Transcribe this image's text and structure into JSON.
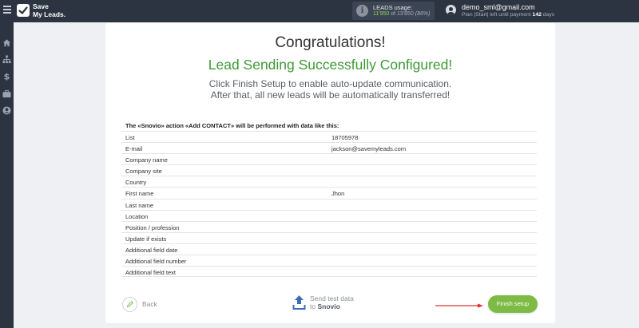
{
  "topbar": {
    "logo_line1": "Save",
    "logo_line2": "My Leads.",
    "usage_label": "LEADS usage:",
    "usage_used": "11'950",
    "usage_of": " of ",
    "usage_total": "13'850",
    "usage_percent": "(86%)",
    "usage_fraction": 0.86,
    "user_email": "demo_sml@gmail.com",
    "plan_prefix": "Plan |Start| left until payment ",
    "plan_days": "142",
    "plan_suffix": " days"
  },
  "sidebar": {
    "icons": [
      "home-icon",
      "sitemap-icon",
      "dollar-icon",
      "briefcase-icon",
      "user-circle-icon"
    ]
  },
  "main": {
    "title": "Congratulations!",
    "subtitle": "Lead Sending Successfully Configured!",
    "hint_line1": "Click Finish Setup to enable auto-update communication.",
    "hint_line2": "After that, all new leads will be automatically transferred!",
    "table_header": "The «Snovio» action «Add CONTACT» will be performed with data like this:",
    "rows": [
      {
        "field": "List",
        "value": "18705978"
      },
      {
        "field": "E-mail",
        "value": "jackson@savemyleads.com"
      },
      {
        "field": "Company name",
        "value": ""
      },
      {
        "field": "Company site",
        "value": ""
      },
      {
        "field": "Country",
        "value": ""
      },
      {
        "field": "First name",
        "value": "Jhon"
      },
      {
        "field": "Last name",
        "value": ""
      },
      {
        "field": "Location",
        "value": ""
      },
      {
        "field": "Position / profession",
        "value": ""
      },
      {
        "field": "Update if exists",
        "value": ""
      },
      {
        "field": "Additional field date",
        "value": ""
      },
      {
        "field": "Additional field number",
        "value": ""
      },
      {
        "field": "Additional field text",
        "value": ""
      }
    ]
  },
  "footer": {
    "back_label": "Back",
    "test_line1": "Send test data",
    "test_line2_prefix": "to ",
    "test_line2_service": "Snovio",
    "finish_label": "Finish setup"
  },
  "colors": {
    "topbar_bg": "#2c3441",
    "success_green": "#3e9a35",
    "finish_button": "#7dbb45",
    "arrow_red": "#d9302c",
    "test_icon_blue": "#3a6fb5"
  }
}
